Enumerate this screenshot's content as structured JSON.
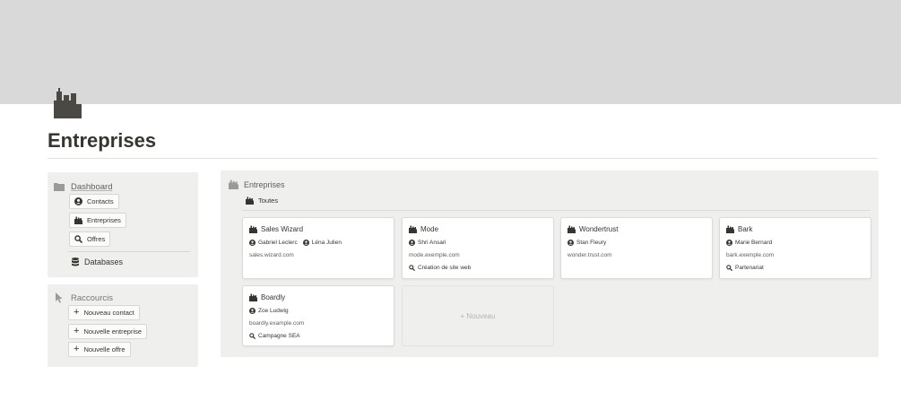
{
  "page": {
    "title": "Entreprises",
    "icon": "buildings-icon"
  },
  "dashboard_panel": {
    "heading": "Dashboard",
    "heading_icon": "folder-icon",
    "links": [
      {
        "label": "Contacts",
        "icon": "person-icon"
      },
      {
        "label": "Entreprises",
        "icon": "buildings-icon"
      },
      {
        "label": "Offres",
        "icon": "search-icon"
      }
    ],
    "databases_label": "Databases",
    "databases_icon": "database-icon"
  },
  "shortcuts_panel": {
    "heading": "Raccourcis",
    "heading_icon": "cursor-icon",
    "buttons": [
      {
        "label": "Nouveau contact",
        "icon": "plus-icon"
      },
      {
        "label": "Nouvelle entreprise",
        "icon": "plus-icon"
      },
      {
        "label": "Nouvelle offre",
        "icon": "plus-icon"
      }
    ]
  },
  "gallery": {
    "title": "Entreprises",
    "view_tab": "Toutes",
    "cards": [
      {
        "name": "Sales Wizard",
        "contacts": [
          "Gabriel Leclerc",
          "Léna Julien"
        ],
        "url": "sales.wizard.com",
        "offer": ""
      },
      {
        "name": "Mode",
        "contacts": [
          "Shri Ansari"
        ],
        "url": "mode.exemple.com",
        "offer": "Création de site web"
      },
      {
        "name": "Wondertrust",
        "contacts": [
          "Stan Fleury"
        ],
        "url": "wonder.trust.com",
        "offer": ""
      },
      {
        "name": "Bark",
        "contacts": [
          "Marie Bernard"
        ],
        "url": "bark.exemple.com",
        "offer": "Partenariat"
      },
      {
        "name": "Boardly",
        "contacts": [
          "Zoe Ludwig"
        ],
        "url": "boardly.example.com",
        "offer": "Campagne SEA"
      }
    ],
    "new_label": "+ Nouveau"
  },
  "colors": {
    "cover": "#d9d9d9",
    "panel_bg": "#efefee",
    "text": "#37352f",
    "muted": "#787774"
  }
}
